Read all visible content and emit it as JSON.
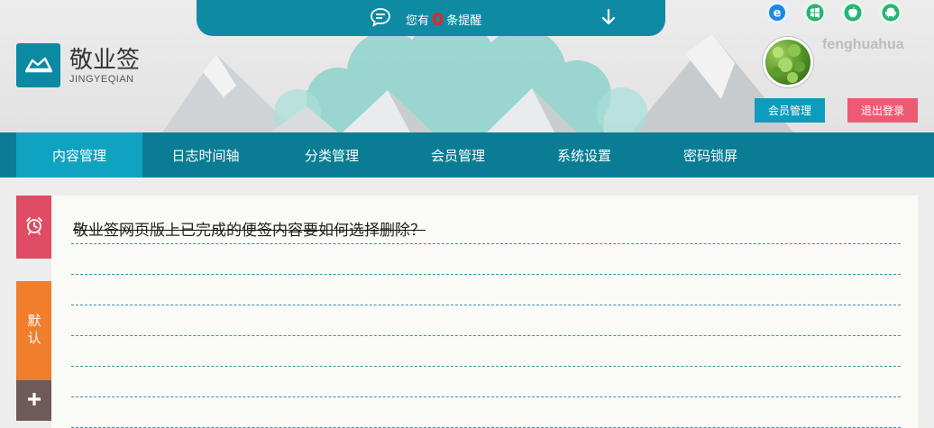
{
  "brand": {
    "title": "敬业签",
    "subtitle": "JINGYEQIAN"
  },
  "notice": {
    "prefix": "您有",
    "count": "0",
    "suffix": "条提醒"
  },
  "platforms": [
    "ie-icon",
    "windows-icon",
    "apple-icon",
    "android-icon"
  ],
  "user": {
    "name": "fenghuahua",
    "member_button": "会员管理",
    "logout_button": "退出登录"
  },
  "nav": {
    "items": [
      {
        "label": "内容管理"
      },
      {
        "label": "日志时间轴"
      },
      {
        "label": "分类管理"
      },
      {
        "label": "会员管理"
      },
      {
        "label": "系统设置"
      },
      {
        "label": "密码锁屏"
      }
    ],
    "active": 0
  },
  "sidebar": {
    "default_tab": "默认"
  },
  "notes": [
    {
      "text": "敬业签网页版上已完成的便签内容要如何选择删除？",
      "completed": true
    }
  ],
  "colors": {
    "teal": "#0a7d94",
    "active_nav": "#0fa3c1",
    "alarm": "#e04c63",
    "default_tab": "#f07e2d",
    "add_tab": "#6f5a5a",
    "logout": "#ef5a73",
    "notice_count": "#e8261e"
  }
}
